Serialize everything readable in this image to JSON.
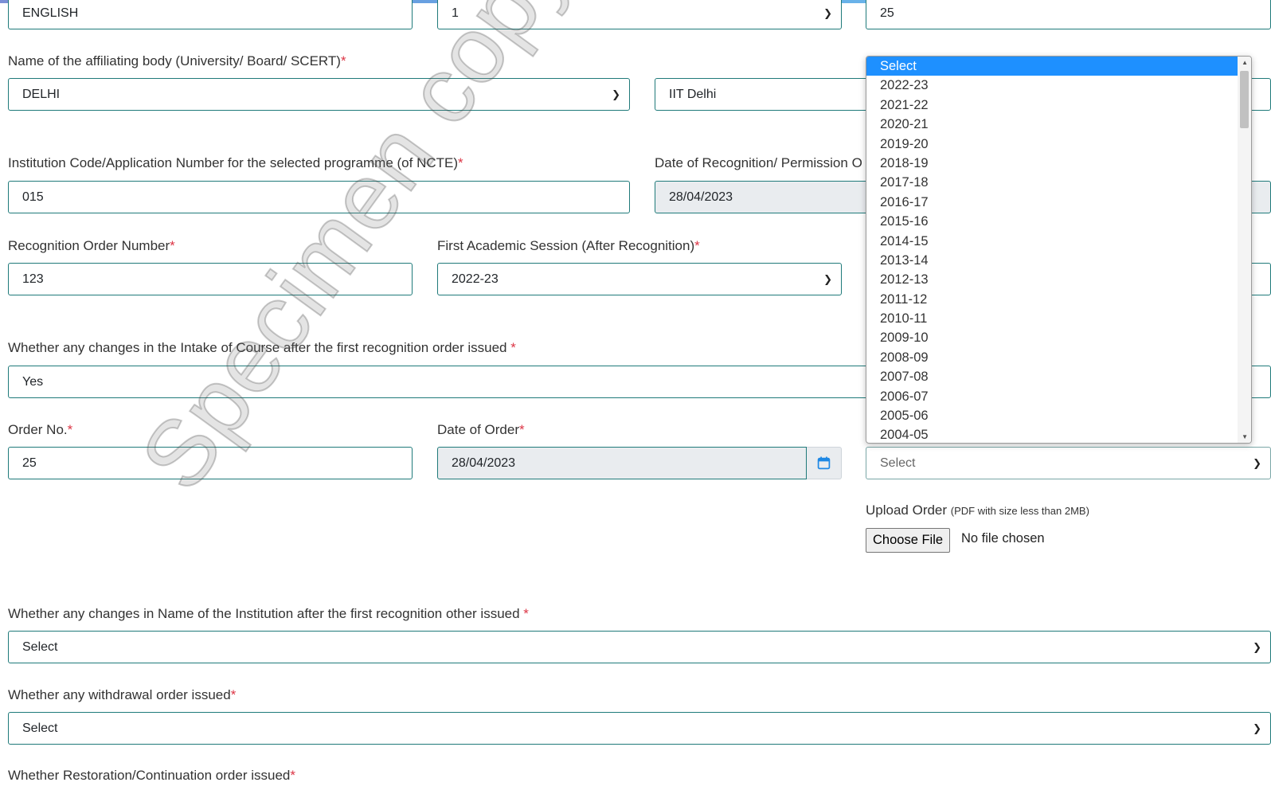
{
  "top_row": {
    "language_value": "ENGLISH",
    "units_value": "1",
    "intake_value": "25"
  },
  "affiliating_body": {
    "label": "Name of the affiliating body (University/ Board/ SCERT)",
    "required": "*",
    "state_value": "DELHI",
    "university_value": "IIT Delhi"
  },
  "institution_code": {
    "label": "Institution Code/Application Number for the selected programme (of NCTE)",
    "required": "*",
    "value": "015"
  },
  "date_recognition": {
    "label": "Date of Recognition/ Permission O",
    "value": "28/04/2023"
  },
  "recognition_order": {
    "label": "Recognition Order Number",
    "required": "*",
    "value": "123"
  },
  "first_session": {
    "label": "First Academic Session (After Recognition)",
    "required": "*",
    "value": "2022-23"
  },
  "intake_change": {
    "label": "Whether any changes in the Intake of Course after the first recognition order issued",
    "required": " *",
    "value": "Yes"
  },
  "order_no": {
    "label": "Order No.",
    "required": "*",
    "value": "25"
  },
  "date_of_order": {
    "label": "Date of Order",
    "required": "*",
    "value": "28/04/2023"
  },
  "session_select": {
    "value": "Select",
    "options": [
      "Select",
      "2022-23",
      "2021-22",
      "2020-21",
      "2019-20",
      "2018-19",
      "2017-18",
      "2016-17",
      "2015-16",
      "2014-15",
      "2013-14",
      "2012-13",
      "2011-12",
      "2010-11",
      "2009-10",
      "2008-09",
      "2007-08",
      "2006-07",
      "2005-06",
      "2004-05"
    ],
    "highlighted_option": "Select"
  },
  "upload": {
    "label": "Upload Order",
    "hint": "(PDF with size less than 2MB)",
    "button": "Choose File",
    "status": "No file chosen"
  },
  "name_change": {
    "label": "Whether any changes in Name of the Institution after the first recognition other issued",
    "required": " *",
    "value": "Select"
  },
  "withdrawal": {
    "label": "Whether any withdrawal order issued",
    "required": "*",
    "value": "Select"
  },
  "restoration": {
    "label": "Whether Restoration/Continuation order issued",
    "required": "*"
  },
  "watermark": "Specimen copy of ITEP",
  "colors": {
    "field_border": "#1f7a7a",
    "required": "#dc3545",
    "highlight": "#1e90ff",
    "disabled_bg": "#e9ecef"
  }
}
